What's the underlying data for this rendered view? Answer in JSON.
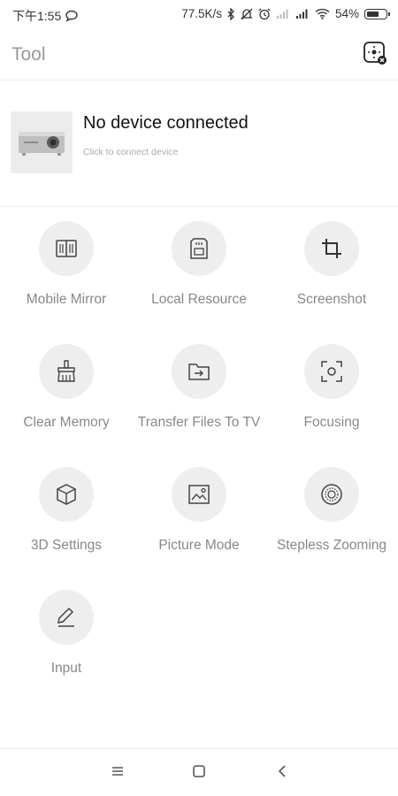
{
  "status_bar": {
    "time": "下午1:55",
    "net_speed": "77.5K/s",
    "battery": "54%",
    "icons": [
      "chat-bubble-icon",
      "bluetooth-icon",
      "mute-icon",
      "alarm-icon",
      "sim-signal-icon",
      "signal-icon",
      "wifi-icon",
      "battery-icon"
    ]
  },
  "header": {
    "title": "Tool",
    "action_icon": "scan-device-icon"
  },
  "device": {
    "title": "No device connected",
    "subtitle": "Click to connect device",
    "image_icon": "projector-icon"
  },
  "tools": [
    {
      "label": "Mobile Mirror",
      "icon": "mirror-icon"
    },
    {
      "label": "Local Resource",
      "icon": "sd-card-icon"
    },
    {
      "label": "Screenshot",
      "icon": "crop-icon"
    },
    {
      "label": "Clear Memory",
      "icon": "broom-icon"
    },
    {
      "label": "Transfer Files To TV",
      "icon": "folder-transfer-icon"
    },
    {
      "label": "Focusing",
      "icon": "focus-icon"
    },
    {
      "label": "3D Settings",
      "icon": "cube-icon"
    },
    {
      "label": "Picture Mode",
      "icon": "picture-icon"
    },
    {
      "label": "Stepless Zooming",
      "icon": "zoom-dial-icon"
    },
    {
      "label": "Input",
      "icon": "pen-icon"
    }
  ],
  "nav": {
    "icons": [
      "menu-icon",
      "home-icon",
      "back-icon"
    ]
  }
}
